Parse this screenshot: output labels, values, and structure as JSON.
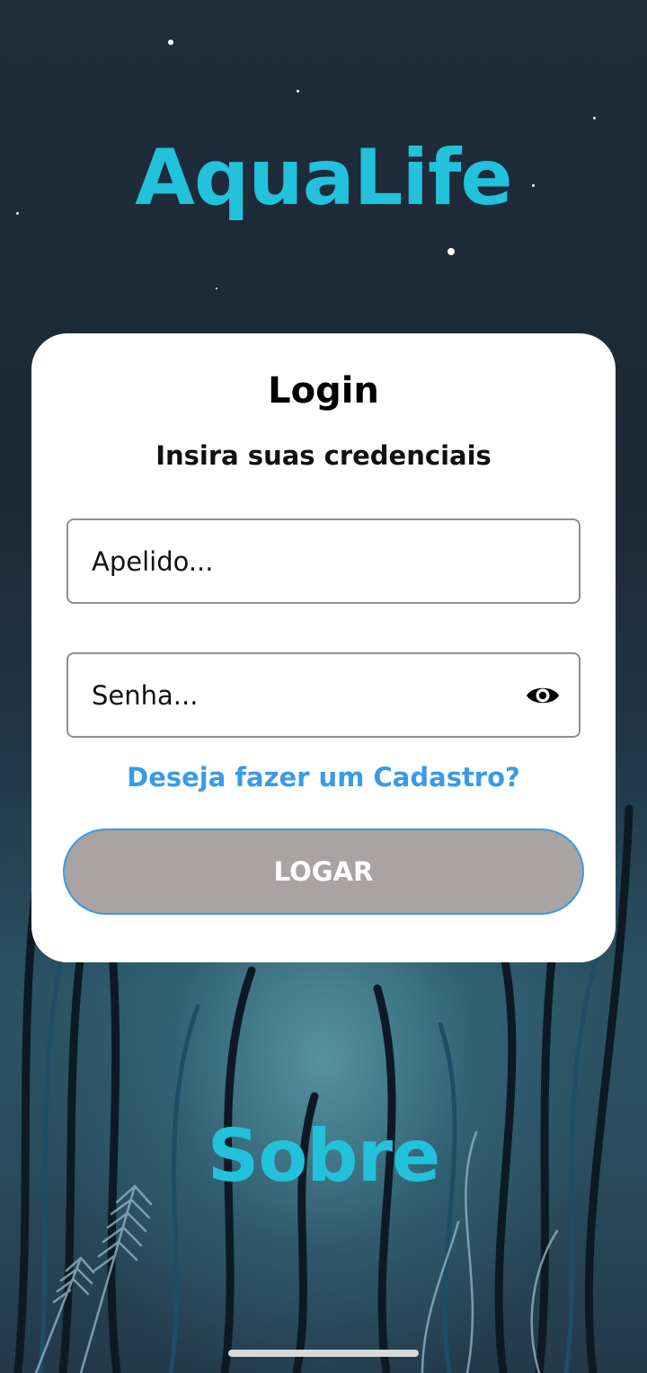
{
  "app": {
    "title": "AquaLife"
  },
  "login_card": {
    "title": "Login",
    "subtitle": "Insira suas credenciais",
    "username_field": {
      "placeholder": "Apelido...",
      "value": ""
    },
    "password_field": {
      "placeholder": "Senha...",
      "value": "",
      "toggle_icon": "eye-icon"
    },
    "signup_link": "Deseja fazer um Cadastro?",
    "submit_label": "LOGAR"
  },
  "footer": {
    "about_label": "Sobre"
  },
  "colors": {
    "brand": "#22c1dc",
    "link": "#3a9ae8",
    "button_bg": "#a9a3a3",
    "card_bg": "#ffffff"
  }
}
